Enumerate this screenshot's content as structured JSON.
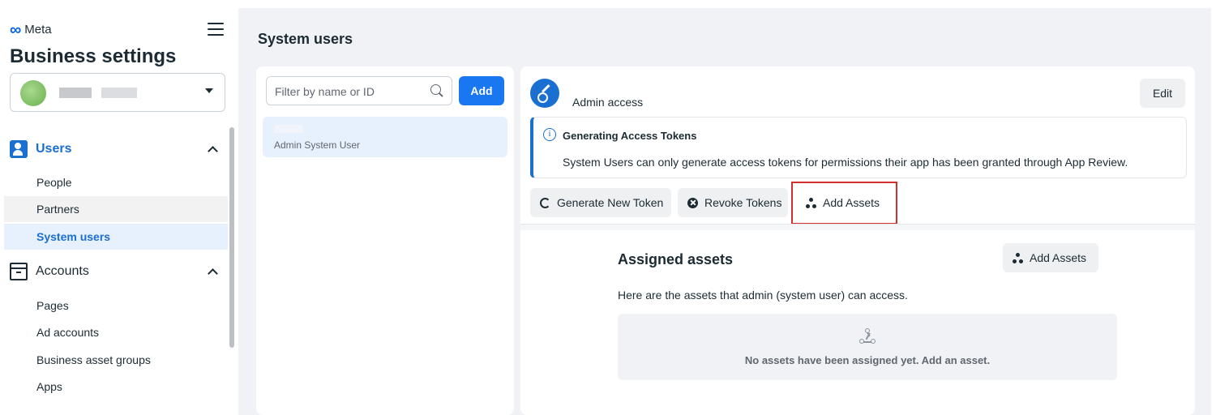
{
  "brand": {
    "logo_text": "Meta",
    "title": "Business settings"
  },
  "sidebar": {
    "sections": [
      {
        "label": "Users",
        "items": [
          "People",
          "Partners",
          "System users"
        ],
        "active_item": "System users"
      },
      {
        "label": "Accounts",
        "items": [
          "Pages",
          "Ad accounts",
          "Business asset groups",
          "Apps"
        ]
      }
    ]
  },
  "main": {
    "page_title": "System users",
    "list": {
      "filter_placeholder": "Filter by name or ID",
      "add_label": "Add",
      "users": [
        {
          "role": "Admin System User"
        }
      ]
    },
    "detail": {
      "access_level": "Admin access",
      "edit_label": "Edit",
      "notice": {
        "title": "Generating Access Tokens",
        "text": "System Users can only generate access tokens for permissions their app has been granted through App Review."
      },
      "actions": {
        "generate": "Generate New Token",
        "revoke": "Revoke Tokens",
        "add_assets": "Add Assets"
      },
      "assets": {
        "title": "Assigned assets",
        "add_label": "Add Assets",
        "description": "Here are the assets that admin (system user) can access.",
        "empty_text": "No assets have been assigned yet. Add an asset."
      }
    }
  },
  "colors": {
    "accent": "#1a77f2",
    "active_bg": "#e7f0fd",
    "highlight": "#d32f2f"
  }
}
